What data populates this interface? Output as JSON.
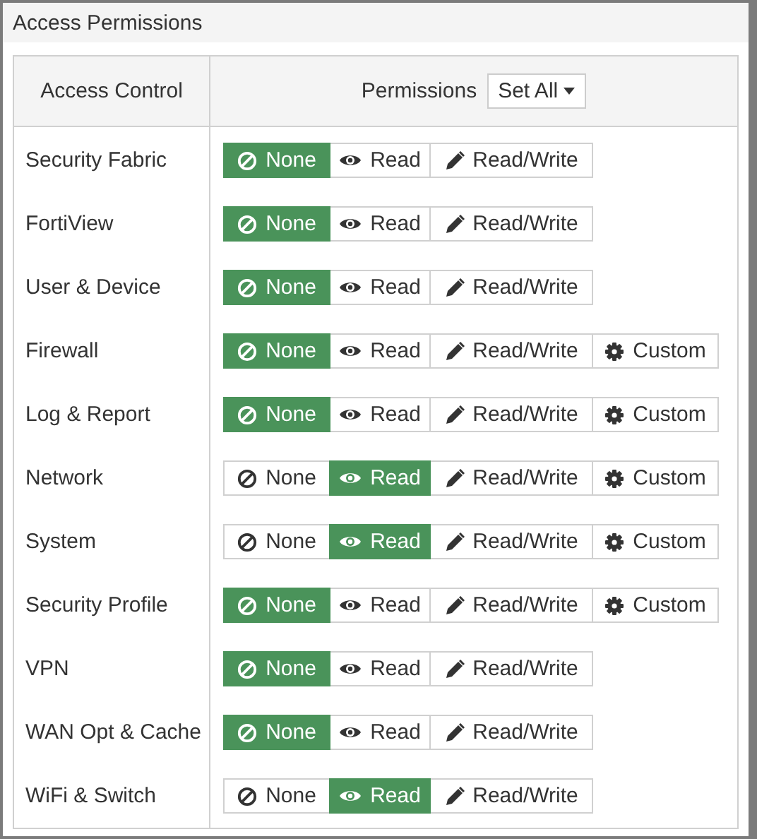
{
  "panel": {
    "title": "Access Permissions"
  },
  "table": {
    "columns": [
      "Access Control",
      "Permissions"
    ],
    "set_all": {
      "label": "Set All"
    },
    "rows": [
      {
        "name": "Security Fabric",
        "options": [
          {
            "kind": "none",
            "label": "None",
            "selected": true
          },
          {
            "kind": "read",
            "label": "Read",
            "selected": false
          },
          {
            "kind": "readwrite",
            "label": "Read/Write",
            "selected": false
          }
        ]
      },
      {
        "name": "FortiView",
        "options": [
          {
            "kind": "none",
            "label": "None",
            "selected": true
          },
          {
            "kind": "read",
            "label": "Read",
            "selected": false
          },
          {
            "kind": "readwrite",
            "label": "Read/Write",
            "selected": false
          }
        ]
      },
      {
        "name": "User & Device",
        "options": [
          {
            "kind": "none",
            "label": "None",
            "selected": true
          },
          {
            "kind": "read",
            "label": "Read",
            "selected": false
          },
          {
            "kind": "readwrite",
            "label": "Read/Write",
            "selected": false
          }
        ]
      },
      {
        "name": "Firewall",
        "options": [
          {
            "kind": "none",
            "label": "None",
            "selected": true
          },
          {
            "kind": "read",
            "label": "Read",
            "selected": false
          },
          {
            "kind": "readwrite",
            "label": "Read/Write",
            "selected": false
          },
          {
            "kind": "custom",
            "label": "Custom",
            "selected": false
          }
        ]
      },
      {
        "name": "Log & Report",
        "options": [
          {
            "kind": "none",
            "label": "None",
            "selected": true
          },
          {
            "kind": "read",
            "label": "Read",
            "selected": false
          },
          {
            "kind": "readwrite",
            "label": "Read/Write",
            "selected": false
          },
          {
            "kind": "custom",
            "label": "Custom",
            "selected": false
          }
        ]
      },
      {
        "name": "Network",
        "options": [
          {
            "kind": "none",
            "label": "None",
            "selected": false
          },
          {
            "kind": "read",
            "label": "Read",
            "selected": true
          },
          {
            "kind": "readwrite",
            "label": "Read/Write",
            "selected": false
          },
          {
            "kind": "custom",
            "label": "Custom",
            "selected": false
          }
        ]
      },
      {
        "name": "System",
        "options": [
          {
            "kind": "none",
            "label": "None",
            "selected": false
          },
          {
            "kind": "read",
            "label": "Read",
            "selected": true
          },
          {
            "kind": "readwrite",
            "label": "Read/Write",
            "selected": false
          },
          {
            "kind": "custom",
            "label": "Custom",
            "selected": false
          }
        ]
      },
      {
        "name": "Security Profile",
        "options": [
          {
            "kind": "none",
            "label": "None",
            "selected": true
          },
          {
            "kind": "read",
            "label": "Read",
            "selected": false
          },
          {
            "kind": "readwrite",
            "label": "Read/Write",
            "selected": false
          },
          {
            "kind": "custom",
            "label": "Custom",
            "selected": false
          }
        ]
      },
      {
        "name": "VPN",
        "options": [
          {
            "kind": "none",
            "label": "None",
            "selected": true
          },
          {
            "kind": "read",
            "label": "Read",
            "selected": false
          },
          {
            "kind": "readwrite",
            "label": "Read/Write",
            "selected": false
          }
        ]
      },
      {
        "name": "WAN Opt & Cache",
        "options": [
          {
            "kind": "none",
            "label": "None",
            "selected": true
          },
          {
            "kind": "read",
            "label": "Read",
            "selected": false
          },
          {
            "kind": "readwrite",
            "label": "Read/Write",
            "selected": false
          }
        ]
      },
      {
        "name": "WiFi & Switch",
        "options": [
          {
            "kind": "none",
            "label": "None",
            "selected": false
          },
          {
            "kind": "read",
            "label": "Read",
            "selected": true
          },
          {
            "kind": "readwrite",
            "label": "Read/Write",
            "selected": false
          }
        ]
      }
    ]
  }
}
